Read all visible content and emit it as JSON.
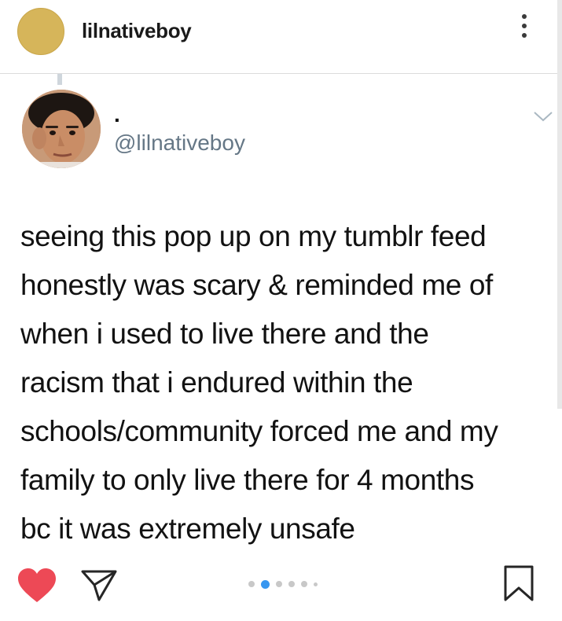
{
  "post": {
    "username": "lilnativeboy",
    "avatar_color": "#d6b55a",
    "more_icon": "more-options-icon"
  },
  "tweet": {
    "display_name": ".",
    "handle": "@lilnativeboy",
    "text": "seeing this pop up on my tumblr feed\nhonestly was scary & reminded me of\nwhen i used to live there and the\nracism that i endured within the\nschools/community forced me and my\nfamily to only live there for 4 months\nbc it was extremely unsafe",
    "handle_color": "#657786"
  },
  "actions": {
    "like_icon": "heart-icon",
    "like_color": "#ed4956",
    "share_icon": "send-icon",
    "save_icon": "bookmark-icon"
  },
  "carousel": {
    "total_dots": 6,
    "active_index": 1,
    "active_color": "#3897f0"
  }
}
